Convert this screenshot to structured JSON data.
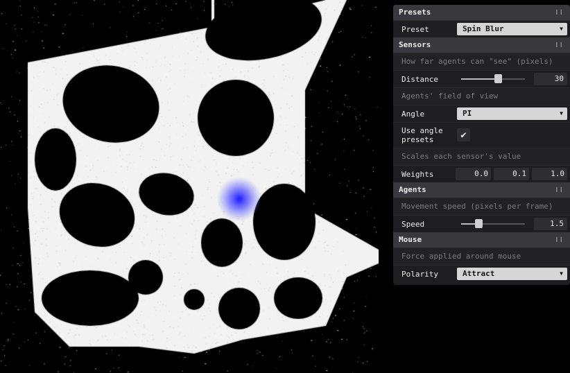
{
  "colors": {
    "panel_bg": "#1e1e20",
    "folder_bg": "#39393d",
    "agents": "#ffffff",
    "mouse_glow": "#4a4aff",
    "background": "#000000"
  },
  "presets": {
    "title": "Presets",
    "preset_label": "Preset",
    "preset_value": "Spin Blur"
  },
  "sensors": {
    "title": "Sensors",
    "distance_note": "How far agents can \"see\" (pixels)",
    "distance_label": "Distance",
    "distance_value": "30",
    "distance_fraction": 0.58,
    "angle_note": "Agents' field of view",
    "angle_label": "Angle",
    "angle_value": "PI",
    "angle_presets_label": "Use angle presets",
    "angle_presets_checked": true,
    "weights_note": "Scales each sensor's value",
    "weights_label": "Weights",
    "weights": [
      "0.0",
      "0.1",
      "1.0"
    ]
  },
  "agents": {
    "title": "Agents",
    "speed_note": "Movement speed (pixels per frame)",
    "speed_label": "Speed",
    "speed_value": "1.5",
    "speed_fraction": 0.27
  },
  "mouse": {
    "title": "Mouse",
    "force_note": "Force applied around mouse",
    "polarity_label": "Polarity",
    "polarity_value": "Attract"
  }
}
